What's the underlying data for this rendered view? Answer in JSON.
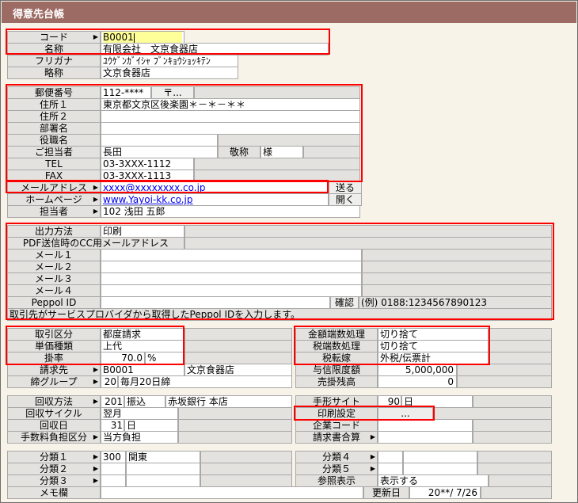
{
  "window": {
    "title": "得意先台帳"
  },
  "basic": {
    "code_label": "コード",
    "code_value": "B0001",
    "name_label": "名称",
    "name_value": "有限会社　文京食器店",
    "furigana_label": "フリガナ",
    "furigana_value": "ﾕｳｹﾞﾝｶﾞｲｼｬ ﾌﾞﾝｷｮｳｼｮｯｷﾃﾝ",
    "short_label": "略称",
    "short_value": "文京食器店"
  },
  "address": {
    "postal_label": "郵便番号",
    "postal_value": "112-****",
    "postal_button": "〒...",
    "addr1_label": "住所１",
    "addr1_value": "東京都文京区後楽園＊－＊－＊＊",
    "addr2_label": "住所２",
    "addr2_value": "",
    "dept_label": "部署名",
    "dept_value": "",
    "title_label": "役職名",
    "title_value": "",
    "contact_label": "ご担当者",
    "contact_value": "長田",
    "honorific_label": "敬称",
    "honorific_value": "様",
    "tel_label": "TEL",
    "tel_value": "03-3XXX-1112",
    "fax_label": "FAX",
    "fax_value": "03-3XXX-1113"
  },
  "contact": {
    "mail_label": "メールアドレス",
    "mail_value": "xxxx@xxxxxxxx.co.jp",
    "mail_button": "送る",
    "web_label": "ホームページ",
    "web_value": "www.Yayoi-kk.co.jp",
    "web_button": "開く",
    "staff_label": "担当者",
    "staff_value": "102 浅田 五郎"
  },
  "output": {
    "method_label": "出力方法",
    "method_value": "印刷",
    "cc_label": "PDF送信時のCC用メールアドレス",
    "mail1_label": "メール１",
    "mail2_label": "メール２",
    "mail3_label": "メール３",
    "mail4_label": "メール４",
    "peppol_label": "Peppol ID",
    "peppol_value": "",
    "confirm_label": "確認",
    "peppol_example": "(例) 0188:1234567890123",
    "peppol_note": "取引先がサービスプロバイダから取得したPeppol IDを入力します。"
  },
  "transaction": {
    "type_label": "取引区分",
    "type_value": "都度請求",
    "price_label": "単価種類",
    "price_value": "上代",
    "rate_label": "掛率",
    "rate_value": "70.0",
    "rate_unit": "%",
    "billto_label": "請求先",
    "billto_code": "B0001",
    "billto_name": "文京食器店",
    "closing_label": "締グループ",
    "closing_code": "20",
    "closing_value": "毎月20日締",
    "rounding_label": "金額端数処理",
    "rounding_value": "切り捨て",
    "tax_rounding_label": "税端数処理",
    "tax_rounding_value": "切り捨て",
    "tax_transfer_label": "税転嫁",
    "tax_transfer_value": "外税/伝票計",
    "credit_label": "与信限度額",
    "credit_value": "5,000,000",
    "ar_label": "売掛残高",
    "ar_value": "0"
  },
  "collection": {
    "method_label": "回収方法",
    "method_code": "201",
    "method_value": "振込",
    "bank_value": "赤坂銀行 本店",
    "cycle_label": "回収サイクル",
    "cycle_value": "翌月",
    "day_label": "回収日",
    "day_value": "31",
    "day_unit": "日",
    "fee_label": "手数料負担区分",
    "fee_value": "当方負担",
    "note_site_label": "手形サイト",
    "note_site_value": "90",
    "note_site_unit": "日",
    "print_label": "印刷設定",
    "print_button": "...",
    "company_code_label": "企業コード",
    "company_code_value": "",
    "invoice_label": "請求書合算",
    "invoice_value": ""
  },
  "classification": {
    "cat1_label": "分類１",
    "cat1_code": "300",
    "cat1_value": "関東",
    "cat2_label": "分類２",
    "cat3_label": "分類３",
    "cat4_label": "分類４",
    "cat5_label": "分類５",
    "ref_label": "参照表示",
    "ref_value": "表示する",
    "memo_label": "メモ欄",
    "memo_value": "",
    "updated_label": "更新日",
    "updated_value": "20**/ 7/26"
  }
}
